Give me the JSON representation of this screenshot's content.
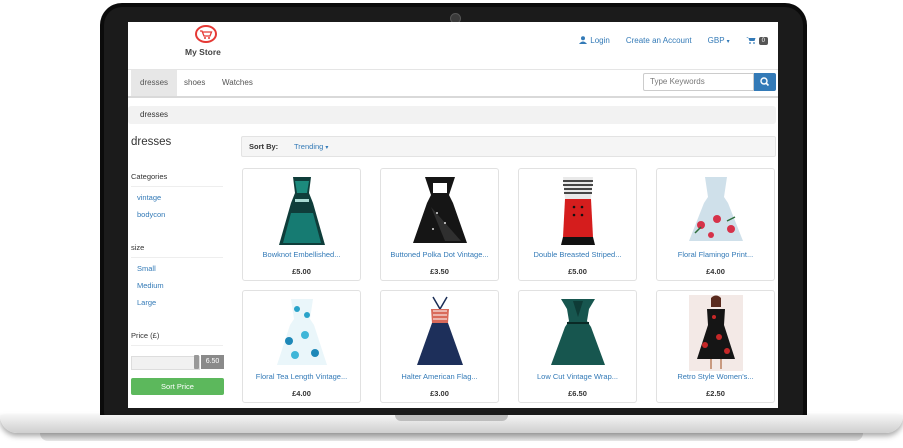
{
  "store": {
    "name": "My Store",
    "brand_color": "#e53935"
  },
  "header": {
    "login": "Login",
    "create_account": "Create an Account",
    "currency": "GBP",
    "cart_count": "0"
  },
  "nav": {
    "tabs": [
      "dresses",
      "shoes",
      "Watches"
    ],
    "active": "dresses",
    "search_placeholder": "Type Keywords"
  },
  "breadcrumb": "dresses",
  "sidebar": {
    "title": "dresses",
    "categories_heading": "Categories",
    "categories": [
      "vintage",
      "bodycon"
    ],
    "size_heading": "size",
    "sizes": [
      "Small",
      "Medium",
      "Large"
    ],
    "price_heading": "Price (£)",
    "price_value": "6.50",
    "sort_price_label": "Sort Price"
  },
  "sort": {
    "label": "Sort By:",
    "value": "Trending"
  },
  "products": [
    {
      "name": "Bowknot Embellished...",
      "price": "£5.00"
    },
    {
      "name": "Buttoned Polka Dot Vintage...",
      "price": "£3.50"
    },
    {
      "name": "Double Breasted Striped...",
      "price": "£5.00"
    },
    {
      "name": "Floral Flamingo Print...",
      "price": "£4.00"
    },
    {
      "name": "Floral Tea Length Vintage...",
      "price": "£4.00"
    },
    {
      "name": "Halter American Flag...",
      "price": "£3.00"
    },
    {
      "name": "Low Cut Vintage Wrap...",
      "price": "£6.50"
    },
    {
      "name": "Retro Style Women's...",
      "price": "£2.50"
    }
  ],
  "colors": {
    "link": "#337ab7",
    "button_green": "#5cb85c"
  }
}
